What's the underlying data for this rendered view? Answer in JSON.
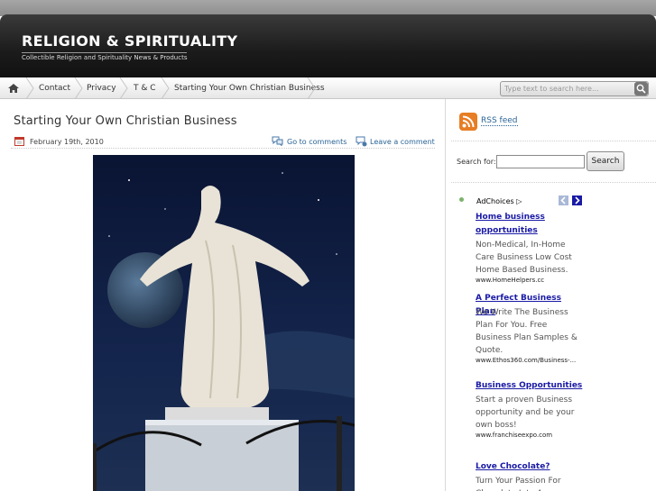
{
  "site": {
    "title": "RELIGION & SPIRITUALITY",
    "tagline": "Collectible Religion and Spirituality News & Products"
  },
  "nav": {
    "home_icon": "home-icon",
    "items": [
      "Contact",
      "Privacy",
      "T & C",
      "Starting Your Own Christian Business"
    ],
    "search_placeholder": "Type text to search here..."
  },
  "post": {
    "title": "Starting Your Own Christian Business",
    "date": "February 19th, 2010",
    "comments_link": "Go to comments",
    "leave_comment_link": "Leave a comment"
  },
  "sidebar": {
    "rss_label": "RSS feed",
    "search_label": "Search for:",
    "search_button": "Search",
    "ads": {
      "adchoices_label": "AdChoices",
      "items": [
        {
          "title": "Home business opportunities",
          "desc": "Non-Medical, In-Home Care Business Low Cost Home Based Business.",
          "url": "www.HomeHelpers.cc"
        },
        {
          "title": "A Perfect Business Plan",
          "desc": "We Write The Business Plan For You. Free Business Plan Samples & Quote.",
          "url": "www.Ethos360.com/Business-..."
        },
        {
          "title": "Business Opportunities",
          "desc": "Start a proven Business opportunity and be your own boss!",
          "url": "www.franchiseexpo.com"
        },
        {
          "title": "Love Chocolate?",
          "desc": "Turn Your Passion For Chocolate Into A Profitable Business.",
          "url": ""
        }
      ]
    }
  },
  "colors": {
    "header": "#1b1b1b",
    "link": "#2a6496",
    "ad_title": "#1a1aa6",
    "rss": "#e0731c"
  }
}
